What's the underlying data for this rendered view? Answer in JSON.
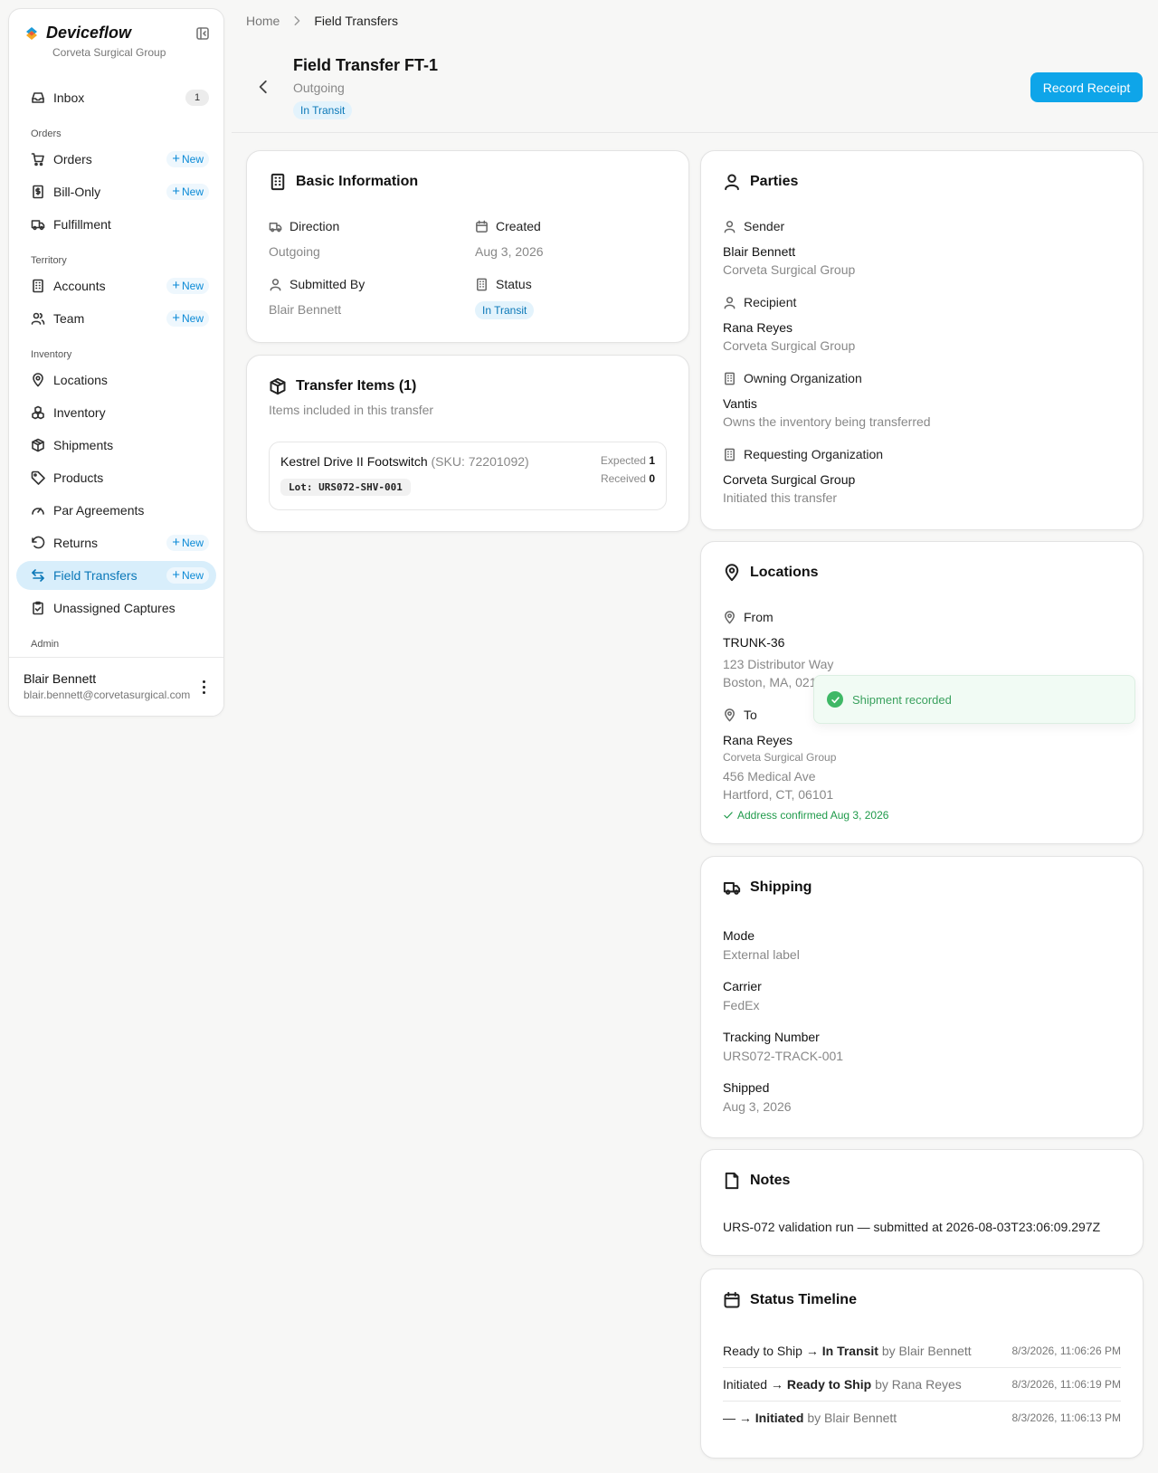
{
  "app": {
    "name": "Deviceflow",
    "org": "Corveta Surgical Group"
  },
  "sidebar": {
    "inbox": {
      "label": "Inbox",
      "count": "1"
    },
    "sections": {
      "orders": "Orders",
      "territory": "Territory",
      "inventory": "Inventory",
      "admin": "Admin"
    },
    "items": {
      "orders": "Orders",
      "bill_only": "Bill-Only",
      "fulfillment": "Fulfillment",
      "accounts": "Accounts",
      "team": "Team",
      "locations": "Locations",
      "inventory": "Inventory",
      "shipments": "Shipments",
      "products": "Products",
      "par_agreements": "Par Agreements",
      "returns": "Returns",
      "field_transfers": "Field Transfers",
      "unassigned_captures": "Unassigned Captures"
    },
    "new_label": "New",
    "user": {
      "name": "Blair Bennett",
      "email": "blair.bennett@corvetasurgical.com"
    }
  },
  "breadcrumb": {
    "home": "Home",
    "current": "Field Transfers"
  },
  "header": {
    "title": "Field Transfer FT-1",
    "subtitle": "Outgoing",
    "status": "In Transit",
    "record_button": "Record Receipt"
  },
  "basic": {
    "title": "Basic Information",
    "direction_label": "Direction",
    "direction": "Outgoing",
    "created_label": "Created",
    "created": "Aug 3, 2026",
    "submitted_label": "Submitted By",
    "submitted": "Blair Bennett",
    "status_label": "Status",
    "status": "In Transit"
  },
  "items": {
    "title": "Transfer Items (1)",
    "subtitle": "Items included in this transfer",
    "list": [
      {
        "name": "Kestrel Drive II Footswitch",
        "sku": "(SKU: 72201092)",
        "lot": "Lot: URS072-SHV-001",
        "expected_label": "Expected",
        "expected": "1",
        "received_label": "Received",
        "received": "0"
      }
    ]
  },
  "parties": {
    "title": "Parties",
    "sender_label": "Sender",
    "sender_name": "Blair Bennett",
    "sender_org": "Corveta Surgical Group",
    "recipient_label": "Recipient",
    "recipient_name": "Rana Reyes",
    "recipient_org": "Corveta Surgical Group",
    "owning_label": "Owning Organization",
    "owning_name": "Vantis",
    "owning_desc": "Owns the inventory being transferred",
    "requesting_label": "Requesting Organization",
    "requesting_name": "Corveta Surgical Group",
    "requesting_desc": "Initiated this transfer"
  },
  "locations": {
    "title": "Locations",
    "from_label": "From",
    "from_name": "TRUNK-36",
    "from_addr1": "123 Distributor Way",
    "from_addr2": "Boston, MA, 02101",
    "to_label": "To",
    "to_name": "Rana Reyes",
    "to_org": "Corveta Surgical Group",
    "to_addr1": "456 Medical Ave",
    "to_addr2": "Hartford, CT, 06101",
    "confirmed": "Address confirmed Aug 3, 2026"
  },
  "shipping": {
    "title": "Shipping",
    "mode_label": "Mode",
    "mode": "External label",
    "carrier_label": "Carrier",
    "carrier": "FedEx",
    "tracking_label": "Tracking Number",
    "tracking": "URS072-TRACK-001",
    "shipped_label": "Shipped",
    "shipped": "Aug 3, 2026"
  },
  "notes": {
    "title": "Notes",
    "text": "URS-072 validation run — submitted at 2026-08-03T23:06:09.297Z"
  },
  "timeline": {
    "title": "Status Timeline",
    "entries": [
      {
        "from": "Ready to Ship",
        "to": "In Transit",
        "by": "by Blair Bennett",
        "ts": "8/3/2026, 11:06:26 PM"
      },
      {
        "from": "Initiated",
        "to": "Ready to Ship",
        "by": "by Rana Reyes",
        "ts": "8/3/2026, 11:06:19 PM"
      },
      {
        "from": "—",
        "to": "Initiated",
        "by": "by Blair Bennett",
        "ts": "8/3/2026, 11:06:13 PM"
      }
    ]
  },
  "toast": {
    "text": "Shipment recorded"
  },
  "colors": {
    "accent": "#0ea5e9",
    "active_bg": "#d8eefb",
    "success": "#3fb866"
  }
}
